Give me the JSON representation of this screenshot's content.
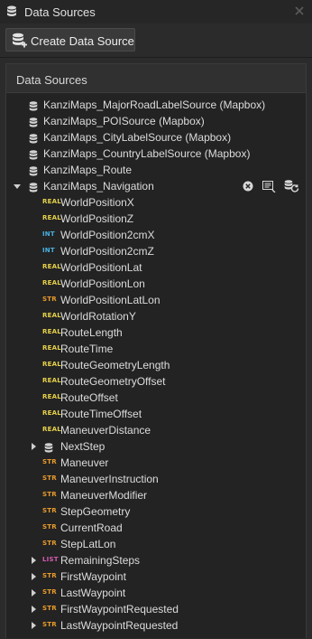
{
  "window": {
    "title": "Data Sources"
  },
  "toolbar": {
    "create_label": "Create Data Source"
  },
  "panel": {
    "header": "Data Sources"
  },
  "sources": [
    {
      "label": "KanziMaps_MajorRoadLabelSource (Mapbox)"
    },
    {
      "label": "KanziMaps_POISource (Mapbox)"
    },
    {
      "label": "KanziMaps_CityLabelSource (Mapbox)"
    },
    {
      "label": "KanziMaps_CountryLabelSource (Mapbox)"
    },
    {
      "label": "KanziMaps_Route"
    },
    {
      "label": "KanziMaps_Navigation",
      "expanded": true
    }
  ],
  "fields": [
    {
      "type": "REAL",
      "label": "WorldPositionX"
    },
    {
      "type": "REAL",
      "label": "WorldPositionZ"
    },
    {
      "type": "INT",
      "label": "WorldPosition2cmX"
    },
    {
      "type": "INT",
      "label": "WorldPosition2cmZ"
    },
    {
      "type": "REAL",
      "label": "WorldPositionLat"
    },
    {
      "type": "REAL",
      "label": "WorldPositionLon"
    },
    {
      "type": "STR",
      "label": "WorldPositionLatLon"
    },
    {
      "type": "REAL",
      "label": "WorldRotationY"
    },
    {
      "type": "REAL",
      "label": "RouteLength"
    },
    {
      "type": "REAL",
      "label": "RouteTime"
    },
    {
      "type": "REAL",
      "label": "RouteGeometryLength"
    },
    {
      "type": "REAL",
      "label": "RouteGeometryOffset"
    },
    {
      "type": "REAL",
      "label": "RouteOffset"
    },
    {
      "type": "REAL",
      "label": "RouteTimeOffset"
    },
    {
      "type": "REAL",
      "label": "ManeuverDistance"
    },
    {
      "type": "DB",
      "label": "NextStep",
      "expandable": true
    },
    {
      "type": "STR",
      "label": "Maneuver"
    },
    {
      "type": "STR",
      "label": "ManeuverInstruction"
    },
    {
      "type": "STR",
      "label": "ManeuverModifier"
    },
    {
      "type": "STR",
      "label": "StepGeometry"
    },
    {
      "type": "STR",
      "label": "CurrentRoad"
    },
    {
      "type": "STR",
      "label": "StepLatLon"
    },
    {
      "type": "LIST",
      "label": "RemainingSteps",
      "expandable": true
    },
    {
      "type": "STR",
      "label": "FirstWaypoint",
      "expandable": true
    },
    {
      "type": "STR",
      "label": "LastWaypoint",
      "expandable": true
    },
    {
      "type": "STR",
      "label": "FirstWaypointRequested",
      "expandable": true
    },
    {
      "type": "STR",
      "label": "LastWaypointRequested",
      "expandable": true
    }
  ],
  "icons": {
    "title": "database-icon",
    "close": "close-icon",
    "create": "database-add-icon",
    "clear": "clear-circle-icon",
    "edit": "edit-source-icon",
    "refresh": "refresh-source-icon"
  },
  "colors": {
    "real": "#e8d24a",
    "int": "#47b0e0",
    "str": "#e89a2c",
    "list": "#d45ab0"
  }
}
